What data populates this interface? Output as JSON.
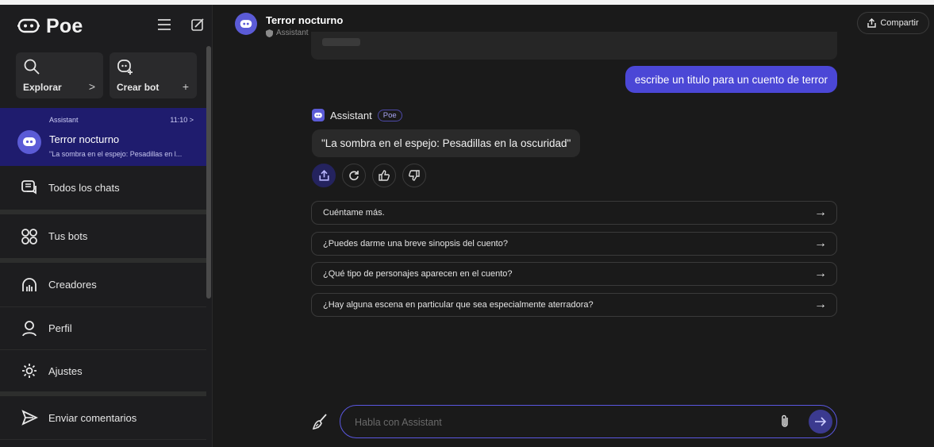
{
  "app": {
    "brand": "Poe"
  },
  "sidebar": {
    "tiles": [
      {
        "label": "Explorar",
        "arrow": ">"
      },
      {
        "label": "Crear bot",
        "arrow": "+"
      }
    ],
    "active_chat": {
      "bot": "Assistant",
      "time": "11:10 >",
      "title": "Terror nocturno",
      "snippet": "\"La sombra en el espejo: Pesadillas en l..."
    },
    "items": [
      {
        "label": "Todos los chats",
        "icon": "chats-icon"
      },
      {
        "label": "Tus bots",
        "icon": "bots-icon"
      },
      {
        "label": "Creadores",
        "icon": "creators-icon"
      },
      {
        "label": "Perfil",
        "icon": "user-icon"
      },
      {
        "label": "Ajustes",
        "icon": "gear-icon"
      },
      {
        "label": "Enviar comentarios",
        "icon": "send-feedback-icon"
      }
    ]
  },
  "header": {
    "title": "Terror nocturno",
    "subtitle": "Assistant",
    "share_label": "Compartir"
  },
  "chat": {
    "user_message": "escribe un titulo para un cuento de terror",
    "bot_name": "Assistant",
    "bot_badge": "Poe",
    "bot_message": "\"La sombra en el espejo: Pesadillas en la oscuridad\"",
    "suggestions": [
      "Cuéntame más.",
      "¿Puedes darme una breve sinopsis del cuento?",
      "¿Qué tipo de personajes aparecen en el cuento?",
      "¿Hay alguna escena en particular que sea especialmente aterradora?"
    ]
  },
  "input": {
    "placeholder": "Habla con Assistant",
    "value": ""
  },
  "colors": {
    "accent": "#4b47d6",
    "active_bg": "#1f1c6e",
    "background": "#1a1a1a"
  }
}
